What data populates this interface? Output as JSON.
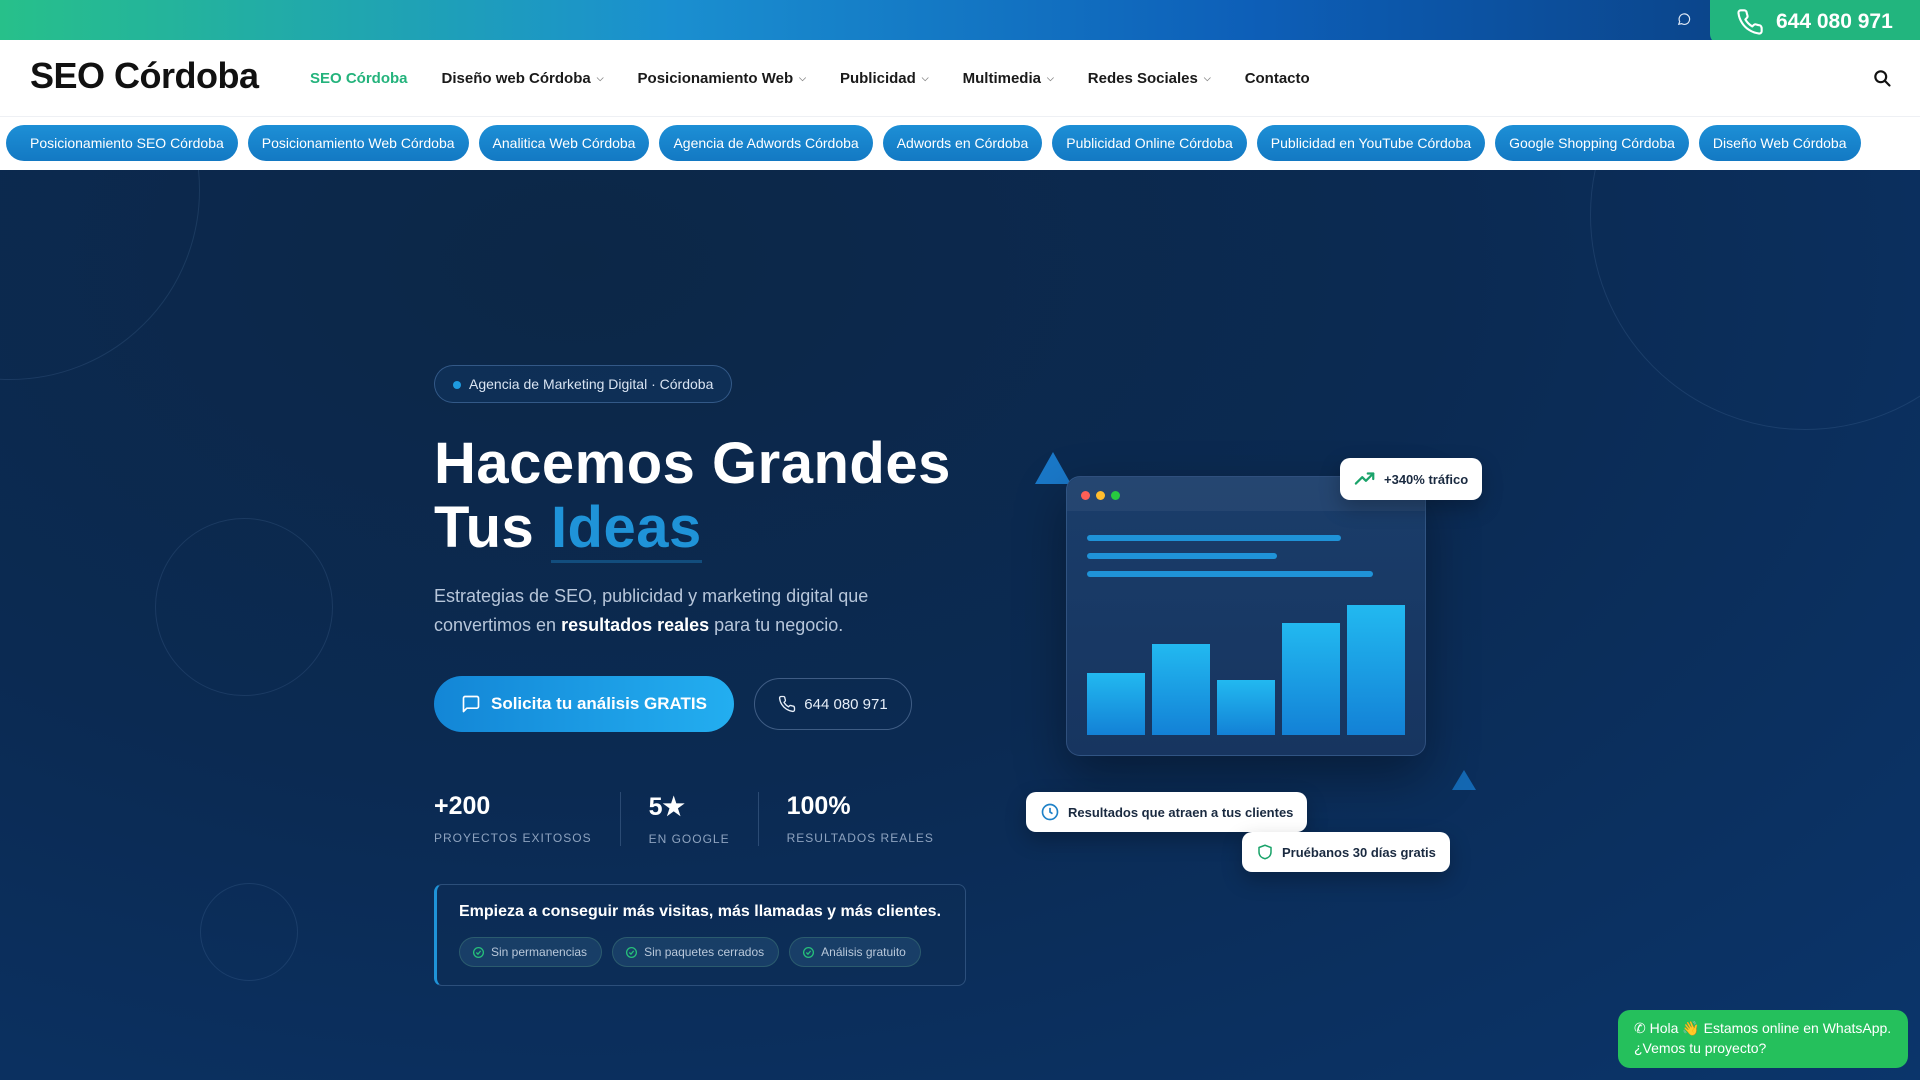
{
  "topbar": {
    "whatsapp_icon": "whatsapp-icon",
    "phone": "644 080 971"
  },
  "nav": {
    "logo": "SEO Córdoba",
    "items": [
      {
        "label": "SEO Córdoba",
        "active": true,
        "dropdown": false
      },
      {
        "label": "Diseño web Córdoba",
        "active": false,
        "dropdown": true
      },
      {
        "label": "Posicionamiento Web",
        "active": false,
        "dropdown": true
      },
      {
        "label": "Publicidad",
        "active": false,
        "dropdown": true
      },
      {
        "label": "Multimedia",
        "active": false,
        "dropdown": true
      },
      {
        "label": "Redes Sociales",
        "active": false,
        "dropdown": true
      },
      {
        "label": "Contacto",
        "active": false,
        "dropdown": false
      }
    ]
  },
  "tags": [
    "Posicionamiento SEO Córdoba",
    "Posicionamiento Web Córdoba",
    "Analitica Web Córdoba",
    "Agencia de Adwords Córdoba",
    "Adwords en Córdoba",
    "Publicidad Online Córdoba",
    "Publicidad en YouTube Córdoba",
    "Google Shopping Córdoba",
    "Diseño Web Córdoba"
  ],
  "hero": {
    "badge": "Agencia de Marketing Digital · Córdoba",
    "title_line1": "Hacemos Grandes",
    "title_line2_prefix": "Tus ",
    "title_accent": "Ideas",
    "lead_before": "Estrategias de SEO, publicidad y marketing digital que convertimos en ",
    "lead_bold": "resultados reales",
    "lead_after": " para tu negocio.",
    "cta_primary": "Solicita tu análisis GRATIS",
    "cta_phone": "644 080 971",
    "stats": [
      {
        "num": "+200",
        "label": "PROYECTOS EXITOSOS"
      },
      {
        "num": "5★",
        "label": "EN GOOGLE"
      },
      {
        "num": "100%",
        "label": "RESULTADOS REALES"
      }
    ],
    "box_title": "Empieza a conseguir más visitas, más llamadas y más clientes.",
    "chips": [
      "Sin permanencias",
      "Sin paquetes cerrados",
      "Análisis gratuito"
    ]
  },
  "mockup": {
    "bars": [
      0.48,
      0.7,
      0.42,
      0.86,
      1.0
    ],
    "float_traffic": "+340% tráfico",
    "float_results": "Resultados que atraen a tus clientes",
    "float_trial": "Pruébanos 30 días gratis"
  },
  "whatsapp": {
    "line1": "Hola 👋 Estamos online en WhatsApp.",
    "line2": "¿Vemos tu proyecto?"
  },
  "colors": {
    "brand_green": "#24b37c",
    "brand_blue": "#1f93d8",
    "hero_bg": "#0b2a52"
  }
}
